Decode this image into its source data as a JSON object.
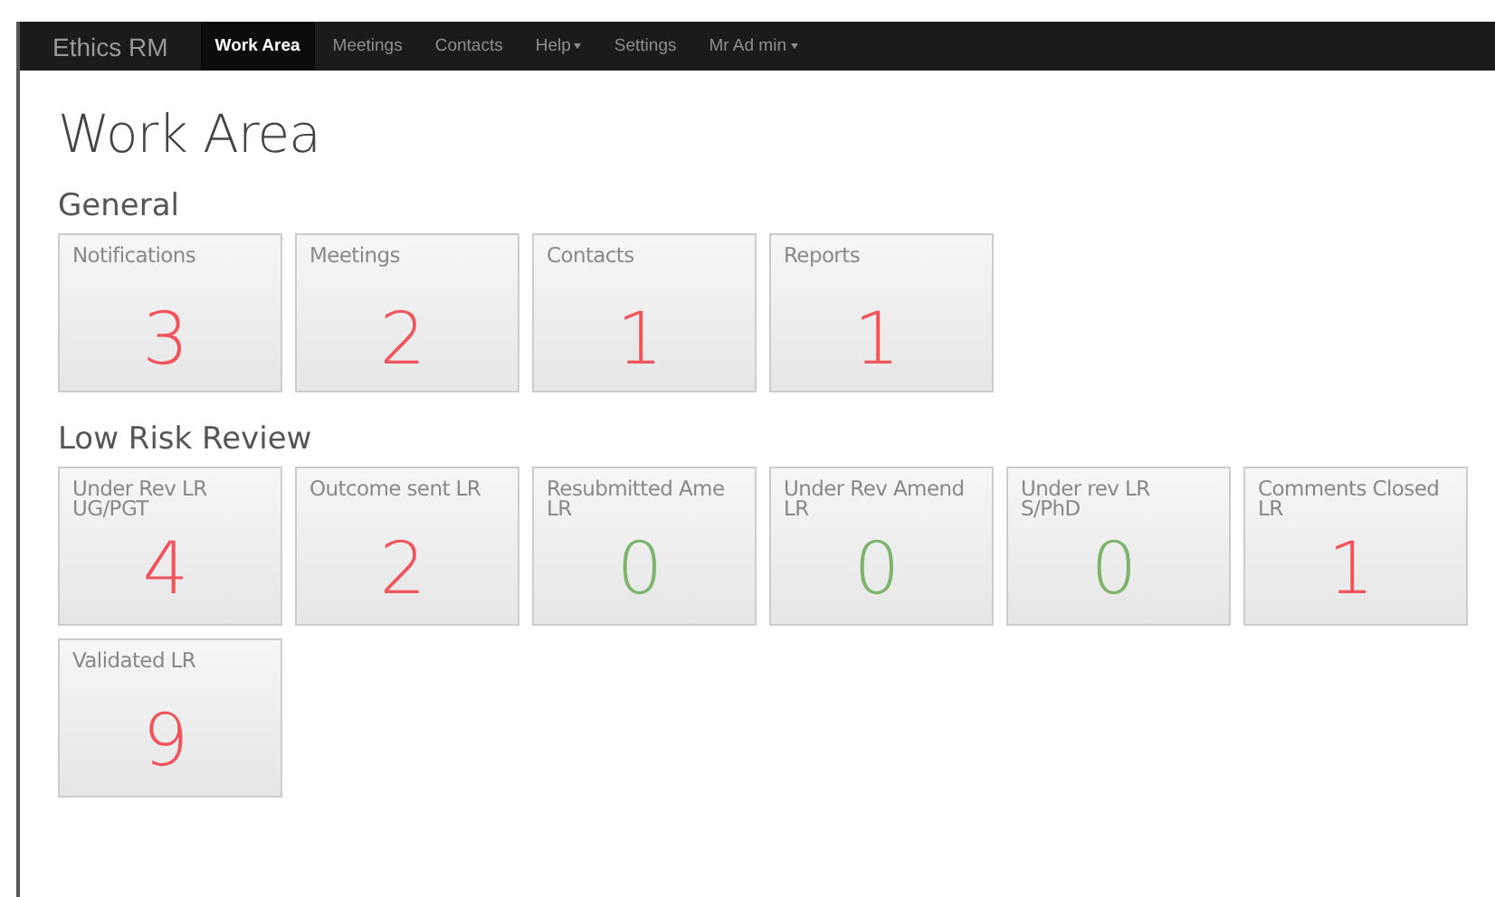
{
  "navbar": {
    "brand": "Ethics RM",
    "items": [
      {
        "label": "Work Area",
        "selected": true,
        "dropdown": false
      },
      {
        "label": "Meetings",
        "selected": false,
        "dropdown": false
      },
      {
        "label": "Contacts",
        "selected": false,
        "dropdown": false
      },
      {
        "label": "Help",
        "selected": false,
        "dropdown": true
      },
      {
        "label": "Settings",
        "selected": false,
        "dropdown": false
      },
      {
        "label": "Mr Ad min",
        "selected": false,
        "dropdown": true
      }
    ]
  },
  "page_title": "Work Area",
  "sections": [
    {
      "title": "General",
      "tiles": [
        {
          "label": "Notifications",
          "count": "3",
          "color": "#f0545a"
        },
        {
          "label": "Meetings",
          "count": "2",
          "color": "#f0545a"
        },
        {
          "label": "Contacts",
          "count": "1",
          "color": "#f0545a"
        },
        {
          "label": "Reports",
          "count": "1",
          "color": "#f0545a"
        }
      ]
    },
    {
      "title": "Low Risk Review",
      "tiles": [
        {
          "label": "Under Rev LR UG/PGT",
          "count": "4",
          "color": "#f0545a"
        },
        {
          "label": "Outcome sent LR",
          "count": "2",
          "color": "#f0545a"
        },
        {
          "label": "Resubmitted Ame LR",
          "count": "0",
          "color": "#7db46c"
        },
        {
          "label": "Under Rev Amend LR",
          "count": "0",
          "color": "#7db46c"
        },
        {
          "label": "Under rev LR S/PhD",
          "count": "0",
          "color": "#7db46c"
        },
        {
          "label": "Comments Closed LR",
          "count": "1",
          "color": "#f0545a"
        },
        {
          "label": "Validated LR",
          "count": "9",
          "color": "#f0545a"
        }
      ]
    }
  ]
}
